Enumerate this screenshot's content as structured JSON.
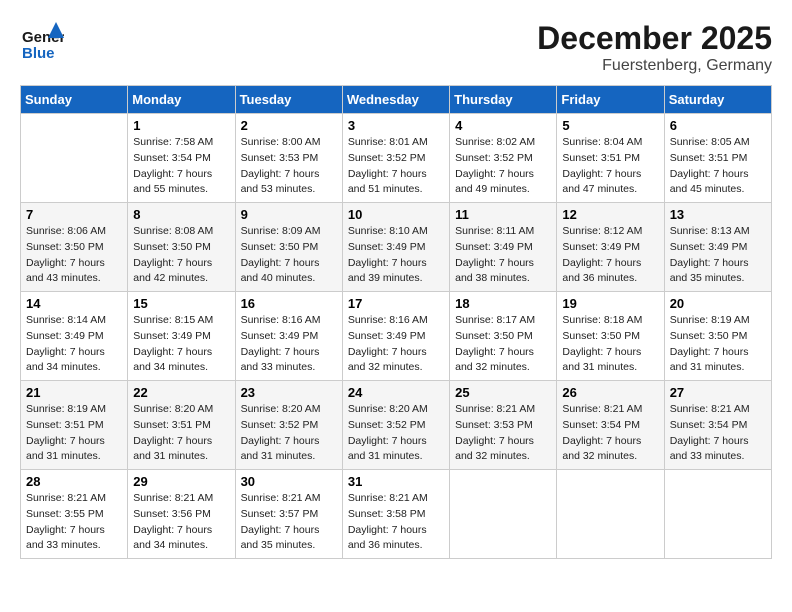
{
  "header": {
    "logo_general": "General",
    "logo_blue": "Blue",
    "month": "December 2025",
    "location": "Fuerstenberg, Germany"
  },
  "days": [
    "Sunday",
    "Monday",
    "Tuesday",
    "Wednesday",
    "Thursday",
    "Friday",
    "Saturday"
  ],
  "weeks": [
    [
      {
        "day": "",
        "sunrise": "",
        "sunset": "",
        "daylight": ""
      },
      {
        "day": "1",
        "sunrise": "Sunrise: 7:58 AM",
        "sunset": "Sunset: 3:54 PM",
        "daylight": "Daylight: 7 hours and 55 minutes."
      },
      {
        "day": "2",
        "sunrise": "Sunrise: 8:00 AM",
        "sunset": "Sunset: 3:53 PM",
        "daylight": "Daylight: 7 hours and 53 minutes."
      },
      {
        "day": "3",
        "sunrise": "Sunrise: 8:01 AM",
        "sunset": "Sunset: 3:52 PM",
        "daylight": "Daylight: 7 hours and 51 minutes."
      },
      {
        "day": "4",
        "sunrise": "Sunrise: 8:02 AM",
        "sunset": "Sunset: 3:52 PM",
        "daylight": "Daylight: 7 hours and 49 minutes."
      },
      {
        "day": "5",
        "sunrise": "Sunrise: 8:04 AM",
        "sunset": "Sunset: 3:51 PM",
        "daylight": "Daylight: 7 hours and 47 minutes."
      },
      {
        "day": "6",
        "sunrise": "Sunrise: 8:05 AM",
        "sunset": "Sunset: 3:51 PM",
        "daylight": "Daylight: 7 hours and 45 minutes."
      }
    ],
    [
      {
        "day": "7",
        "sunrise": "Sunrise: 8:06 AM",
        "sunset": "Sunset: 3:50 PM",
        "daylight": "Daylight: 7 hours and 43 minutes."
      },
      {
        "day": "8",
        "sunrise": "Sunrise: 8:08 AM",
        "sunset": "Sunset: 3:50 PM",
        "daylight": "Daylight: 7 hours and 42 minutes."
      },
      {
        "day": "9",
        "sunrise": "Sunrise: 8:09 AM",
        "sunset": "Sunset: 3:50 PM",
        "daylight": "Daylight: 7 hours and 40 minutes."
      },
      {
        "day": "10",
        "sunrise": "Sunrise: 8:10 AM",
        "sunset": "Sunset: 3:49 PM",
        "daylight": "Daylight: 7 hours and 39 minutes."
      },
      {
        "day": "11",
        "sunrise": "Sunrise: 8:11 AM",
        "sunset": "Sunset: 3:49 PM",
        "daylight": "Daylight: 7 hours and 38 minutes."
      },
      {
        "day": "12",
        "sunrise": "Sunrise: 8:12 AM",
        "sunset": "Sunset: 3:49 PM",
        "daylight": "Daylight: 7 hours and 36 minutes."
      },
      {
        "day": "13",
        "sunrise": "Sunrise: 8:13 AM",
        "sunset": "Sunset: 3:49 PM",
        "daylight": "Daylight: 7 hours and 35 minutes."
      }
    ],
    [
      {
        "day": "14",
        "sunrise": "Sunrise: 8:14 AM",
        "sunset": "Sunset: 3:49 PM",
        "daylight": "Daylight: 7 hours and 34 minutes."
      },
      {
        "day": "15",
        "sunrise": "Sunrise: 8:15 AM",
        "sunset": "Sunset: 3:49 PM",
        "daylight": "Daylight: 7 hours and 34 minutes."
      },
      {
        "day": "16",
        "sunrise": "Sunrise: 8:16 AM",
        "sunset": "Sunset: 3:49 PM",
        "daylight": "Daylight: 7 hours and 33 minutes."
      },
      {
        "day": "17",
        "sunrise": "Sunrise: 8:16 AM",
        "sunset": "Sunset: 3:49 PM",
        "daylight": "Daylight: 7 hours and 32 minutes."
      },
      {
        "day": "18",
        "sunrise": "Sunrise: 8:17 AM",
        "sunset": "Sunset: 3:50 PM",
        "daylight": "Daylight: 7 hours and 32 minutes."
      },
      {
        "day": "19",
        "sunrise": "Sunrise: 8:18 AM",
        "sunset": "Sunset: 3:50 PM",
        "daylight": "Daylight: 7 hours and 31 minutes."
      },
      {
        "day": "20",
        "sunrise": "Sunrise: 8:19 AM",
        "sunset": "Sunset: 3:50 PM",
        "daylight": "Daylight: 7 hours and 31 minutes."
      }
    ],
    [
      {
        "day": "21",
        "sunrise": "Sunrise: 8:19 AM",
        "sunset": "Sunset: 3:51 PM",
        "daylight": "Daylight: 7 hours and 31 minutes."
      },
      {
        "day": "22",
        "sunrise": "Sunrise: 8:20 AM",
        "sunset": "Sunset: 3:51 PM",
        "daylight": "Daylight: 7 hours and 31 minutes."
      },
      {
        "day": "23",
        "sunrise": "Sunrise: 8:20 AM",
        "sunset": "Sunset: 3:52 PM",
        "daylight": "Daylight: 7 hours and 31 minutes."
      },
      {
        "day": "24",
        "sunrise": "Sunrise: 8:20 AM",
        "sunset": "Sunset: 3:52 PM",
        "daylight": "Daylight: 7 hours and 31 minutes."
      },
      {
        "day": "25",
        "sunrise": "Sunrise: 8:21 AM",
        "sunset": "Sunset: 3:53 PM",
        "daylight": "Daylight: 7 hours and 32 minutes."
      },
      {
        "day": "26",
        "sunrise": "Sunrise: 8:21 AM",
        "sunset": "Sunset: 3:54 PM",
        "daylight": "Daylight: 7 hours and 32 minutes."
      },
      {
        "day": "27",
        "sunrise": "Sunrise: 8:21 AM",
        "sunset": "Sunset: 3:54 PM",
        "daylight": "Daylight: 7 hours and 33 minutes."
      }
    ],
    [
      {
        "day": "28",
        "sunrise": "Sunrise: 8:21 AM",
        "sunset": "Sunset: 3:55 PM",
        "daylight": "Daylight: 7 hours and 33 minutes."
      },
      {
        "day": "29",
        "sunrise": "Sunrise: 8:21 AM",
        "sunset": "Sunset: 3:56 PM",
        "daylight": "Daylight: 7 hours and 34 minutes."
      },
      {
        "day": "30",
        "sunrise": "Sunrise: 8:21 AM",
        "sunset": "Sunset: 3:57 PM",
        "daylight": "Daylight: 7 hours and 35 minutes."
      },
      {
        "day": "31",
        "sunrise": "Sunrise: 8:21 AM",
        "sunset": "Sunset: 3:58 PM",
        "daylight": "Daylight: 7 hours and 36 minutes."
      },
      {
        "day": "",
        "sunrise": "",
        "sunset": "",
        "daylight": ""
      },
      {
        "day": "",
        "sunrise": "",
        "sunset": "",
        "daylight": ""
      },
      {
        "day": "",
        "sunrise": "",
        "sunset": "",
        "daylight": ""
      }
    ]
  ]
}
